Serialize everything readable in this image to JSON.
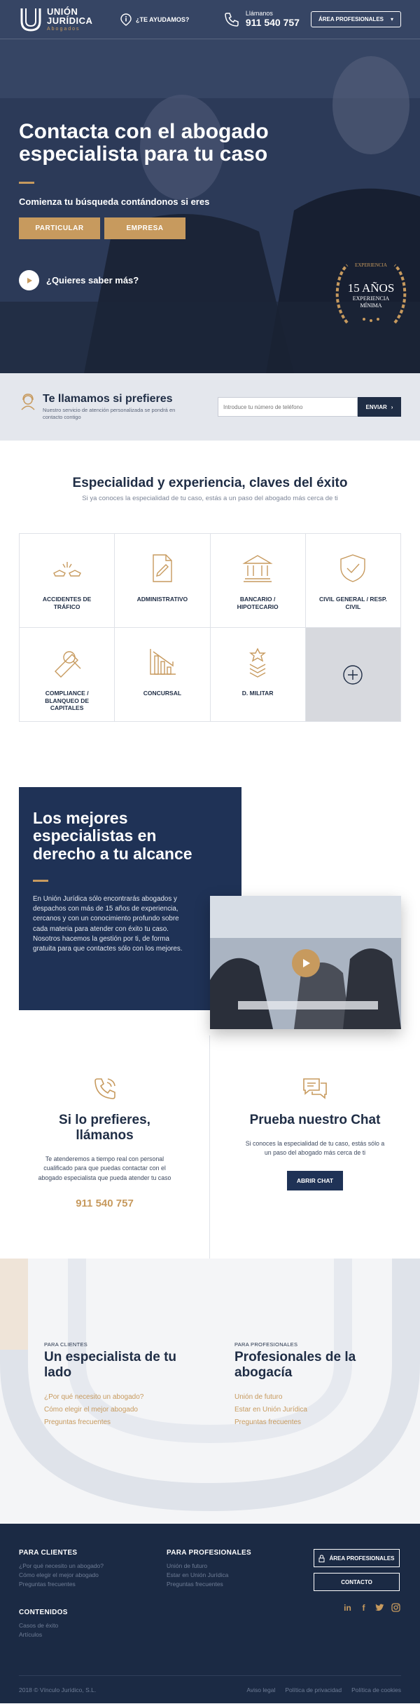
{
  "header": {
    "logo_line1": "UNIÓN",
    "logo_line2": "JURÍDICA",
    "logo_line3": "Abogados",
    "help_label": "¿TE AYUDAMOS?",
    "call_label": "Llámanos",
    "phone": "911 540 757",
    "area_button": "ÁREA PROFESIONALES"
  },
  "hero": {
    "title": "Contacta con el abogado especialista para tu caso",
    "subtitle": "Comienza tu búsqueda contándonos si eres",
    "btn_particular": "PARTICULAR",
    "btn_empresa": "EMPRESA",
    "more_label": "¿Quieres saber más?",
    "badge": {
      "top": "EXPERIENCIA",
      "big": "15 AÑOS",
      "line2": "EXPERIENCIA",
      "line3": "MÍNIMA"
    }
  },
  "callback": {
    "title": "Te llamamos si prefieres",
    "description": "Nuestro servicio de atención personalizada se pondrá en contacto contigo",
    "input_placeholder": "Introduce tu número de teléfono",
    "send_label": "ENVIAR"
  },
  "specialties": {
    "title": "Especialidad y experiencia, claves del éxito",
    "subtitle": "Si ya conoces la especialidad de tu caso, estás a un paso del abogado más cerca de ti",
    "items": [
      {
        "label": "ACCIDENTES DE TRÁFICO",
        "icon": "car-crash-icon"
      },
      {
        "label": "ADMINISTRATIVO",
        "icon": "document-icon"
      },
      {
        "label": "BANCARIO / HIPOTECARIO",
        "icon": "bank-icon"
      },
      {
        "label": "CIVIL GENERAL / RESP. CIVIL",
        "icon": "shield-icon"
      },
      {
        "label": "COMPLIANCE / BLANQUEO DE CAPITALES",
        "icon": "search-document-icon"
      },
      {
        "label": "CONCURSAL",
        "icon": "chart-down-icon"
      },
      {
        "label": "D. MILITAR",
        "icon": "military-icon"
      }
    ]
  },
  "specialists": {
    "title": "Los mejores especialistas en derecho a tu alcance",
    "text": "En Unión Jurídica sólo encontrarás abogados y despachos con más de 15 años de experiencia, cercanos y con un conocimiento profundo sobre cada materia para atender con éxito tu caso. Nosotros hacemos la gestión por ti, de forma gratuita para que contactes sólo con los mejores."
  },
  "call_option": {
    "title": "Si lo prefieres, llámanos",
    "text": "Te atenderemos a tiempo real con personal cualificado para que puedas contactar con el abogado especialista que pueda atender tu caso",
    "phone": "911 540 757"
  },
  "chat_option": {
    "title": "Prueba nuestro Chat",
    "text": "Si conoces la especialidad de tu caso, estás sólo a un paso del abogado más cerca de ti",
    "button": "ABRIR CHAT"
  },
  "clients": {
    "small": "PARA CLIENTES",
    "title": "Un especialista de tu lado",
    "links": [
      "¿Por qué necesito un abogado?",
      "Cómo elegir el mejor abogado",
      "Preguntas frecuentes"
    ]
  },
  "professionals": {
    "small": "PARA PROFESIONALES",
    "title": "Profesionales de la abogacía",
    "links": [
      "Unión de futuro",
      "Estar en Unión Jurídica",
      "Preguntas frecuentes"
    ]
  },
  "footer": {
    "clients_title": "PARA CLIENTES",
    "clients_links": [
      "¿Por qué necesito un abogado?",
      "Cómo elegir el mejor abogado",
      "Preguntas frecuentes"
    ],
    "prof_title": "PARA PROFESIONALES",
    "prof_links": [
      "Unión de futuro",
      "Estar en Unión Jurídica",
      "Preguntas frecuentes"
    ],
    "content_title": "CONTENIDOS",
    "content_links": [
      "Casos de éxito",
      "Artículos"
    ],
    "area_button": "ÁREA PROFESIONALES",
    "contact_button": "CONTACTO",
    "copyright": "2018 © Vínculo Jurídico, S.L.",
    "legal": [
      "Aviso legal",
      "Política de privacidad",
      "Política de cookies"
    ]
  },
  "colors": {
    "navy": "#1f3256",
    "gold": "#c79a5e",
    "footer": "#1b2a44"
  }
}
